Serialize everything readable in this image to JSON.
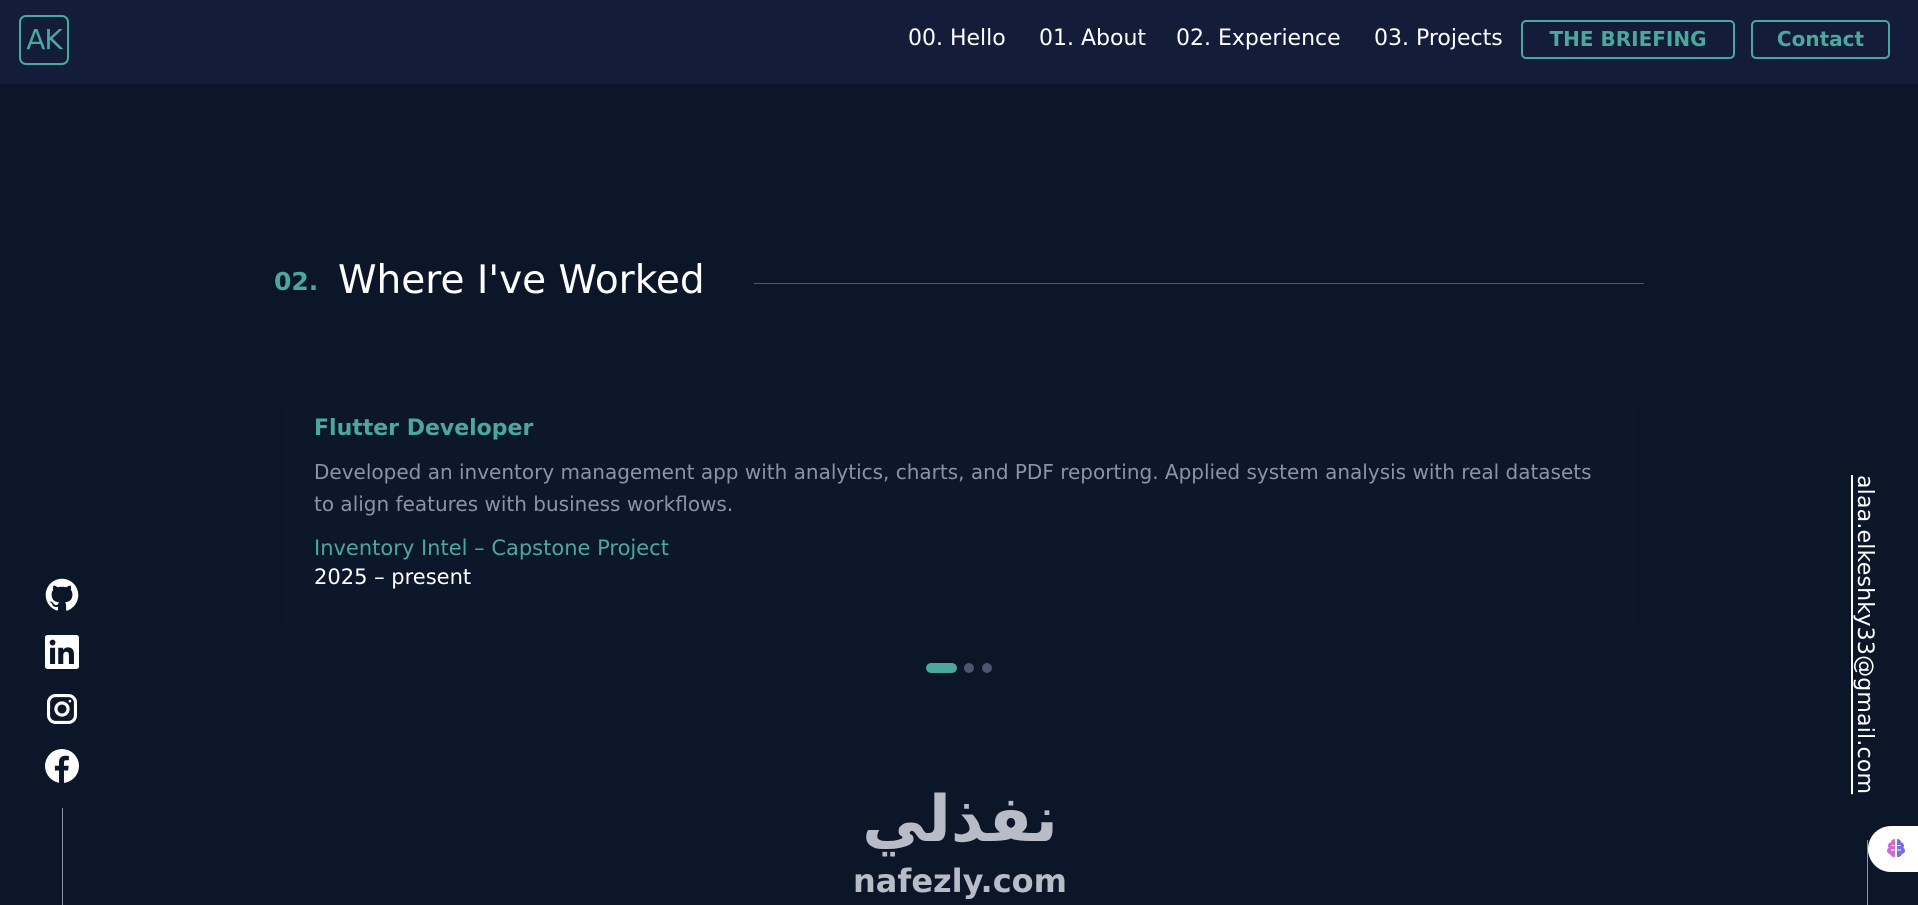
{
  "header": {
    "logo": "AK",
    "nav": [
      {
        "label": "00. Hello"
      },
      {
        "label": "01. About"
      },
      {
        "label": "02. Experience"
      },
      {
        "label": "03. Projects"
      }
    ],
    "briefing_label": "THE BRIEFING",
    "contact_label": "Contact"
  },
  "section": {
    "number": "02.",
    "title": "Where I've Worked"
  },
  "experience": {
    "role": "Flutter Developer",
    "description": "Developed an inventory management app with analytics, charts, and PDF reporting. Applied system analysis with real datasets to align features with business workflows.",
    "company": "Inventory Intel – Capstone Project",
    "period": "2025 – present"
  },
  "carousel": {
    "total": 3,
    "active_index": 0
  },
  "social": {
    "icons": [
      "github-icon",
      "linkedin-icon",
      "instagram-icon",
      "facebook-icon"
    ]
  },
  "email": "alaa.elkeshky33@gmail.com",
  "watermark": {
    "arabic": "نفذلي",
    "latin": "nafezly.com"
  },
  "colors": {
    "background": "#0c1629",
    "header": "#131c38",
    "accent": "#4aa89c",
    "muted_text": "#8a93a8",
    "text": "#ffffff"
  }
}
